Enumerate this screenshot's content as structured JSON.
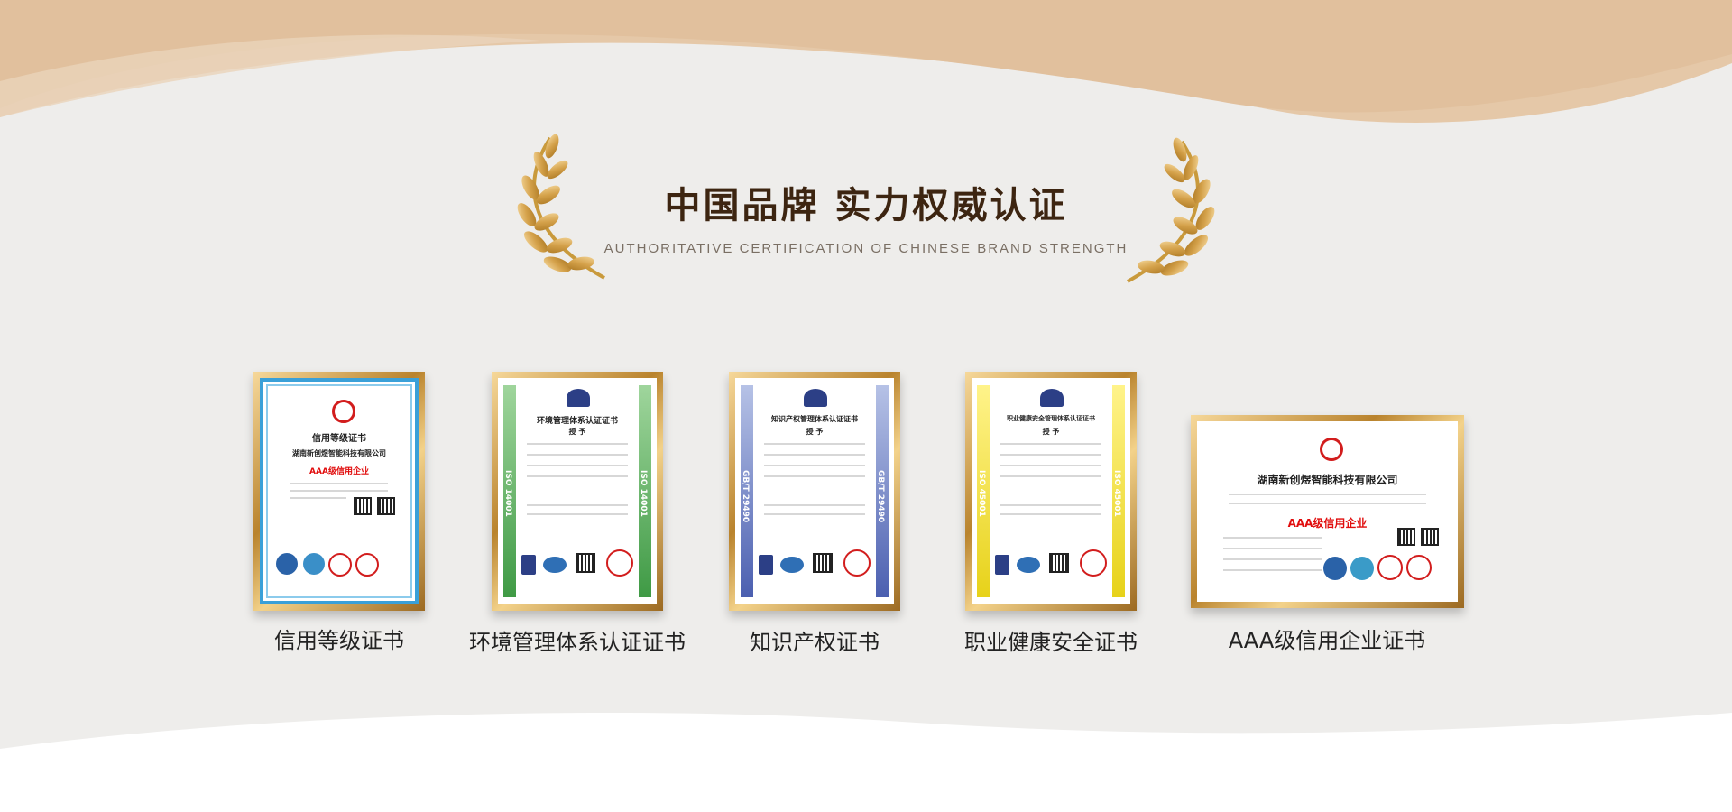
{
  "header": {
    "title": "中国品牌 实力权威认证",
    "subtitle": "AUTHORITATIVE CERTIFICATION OF CHINESE BRAND STRENGTH"
  },
  "colors": {
    "background": "#eeedeb",
    "top_wave": "#e2c3a2",
    "title": "#3d2511",
    "gold": "#c99a3c"
  },
  "certificates": [
    {
      "caption": "信用等级证书",
      "heading": "信用等级证书",
      "company": "湖南新创煜智能科技有限公司",
      "grade": "AAA级信用企业"
    },
    {
      "caption": "环境管理体系认证证书",
      "heading": "环境管理体系认证证书",
      "sub": "授 予",
      "side_label": "ISO 14001"
    },
    {
      "caption": "知识产权证书",
      "heading": "知识产权管理体系认证证书",
      "sub": "授 予",
      "side_label": "GB/T 29490"
    },
    {
      "caption": "职业健康安全证书",
      "heading": "职业健康安全管理体系认证证书",
      "sub": "授 予",
      "side_label": "ISO 45001"
    },
    {
      "caption": "AAA级信用企业证书",
      "company": "湖南新创煜智能科技有限公司",
      "grade": "AAA级信用企业"
    }
  ],
  "icons": {
    "left_decoration": "laurel-branch-icon",
    "right_decoration": "laurel-branch-icon",
    "badges": [
      "ccaa-logo-icon",
      "iaf-logo-icon",
      "qr-code-icon",
      "seal-icon"
    ]
  }
}
